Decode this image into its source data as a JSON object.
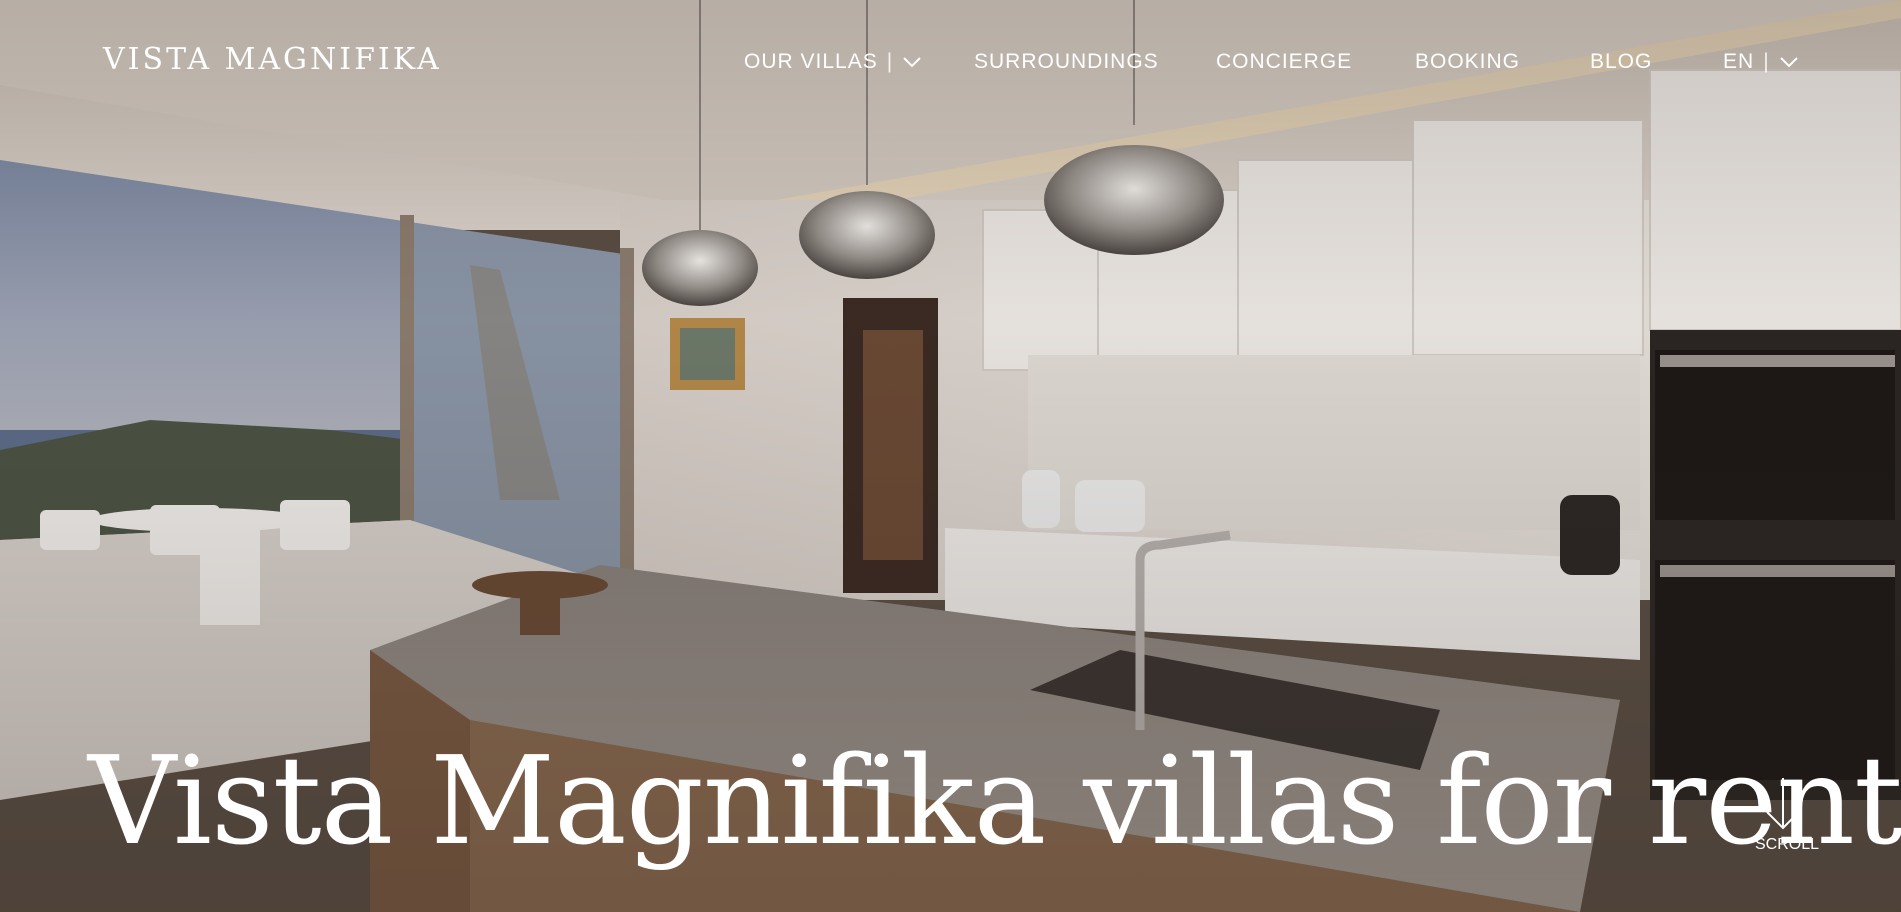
{
  "brand": {
    "logo_text": "VISTA MAGNIFIKA"
  },
  "nav": {
    "items": [
      {
        "label": "OUR VILLAS",
        "has_dropdown": true
      },
      {
        "label": "SURROUNDINGS"
      },
      {
        "label": "CONCIERGE"
      },
      {
        "label": "BOOKING"
      },
      {
        "label": "BLOG"
      }
    ],
    "language": {
      "label": "EN",
      "has_dropdown": true
    },
    "separator": "|"
  },
  "hero": {
    "title": "Vista Magnifika villas for rent",
    "image_alt": "Modern kitchen with pendant lamps and terrace sea view",
    "scroll_label": "SCROLL"
  },
  "icons": {
    "dropdown": "chevron-down-icon",
    "scroll": "arrow-down-icon"
  },
  "colors": {
    "text": "#ffffff",
    "counter": "#8a8480",
    "wall": "#e8e2dc",
    "wood": "#7a5a42"
  }
}
